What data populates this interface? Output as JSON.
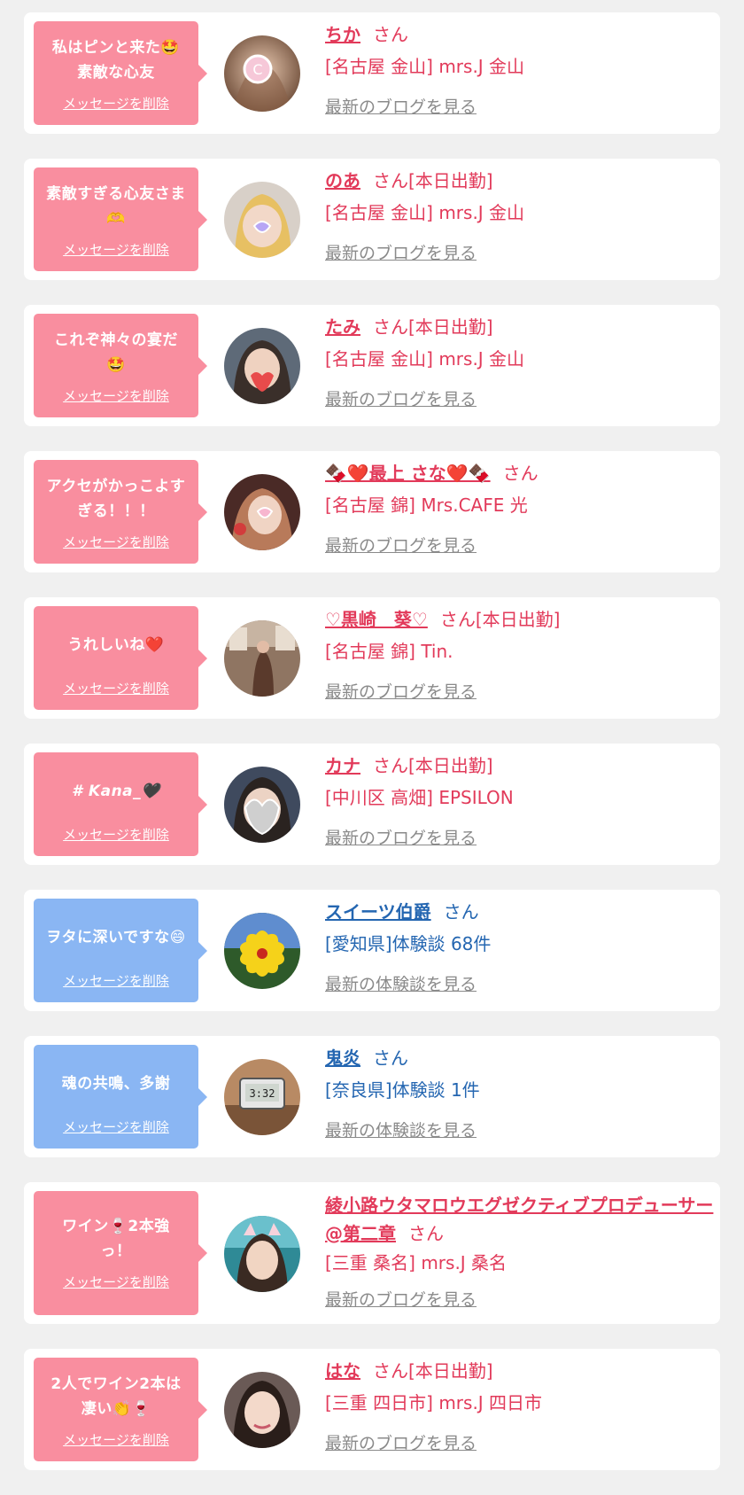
{
  "colors": {
    "pink_bubble": "#f98e9f",
    "blue_bubble": "#8ab6f3",
    "red_text": "#e23a5a",
    "blue_text": "#2466b1",
    "link_gray": "#8a8a8a",
    "page_bg": "#f0f0f0"
  },
  "delete_label": "メッセージを削除",
  "cards": [
    {
      "bubble": "pink",
      "message": "私はピンと来た🤩素敵な心友",
      "name": "ちか",
      "suffix": "さん",
      "tag": "",
      "shop": "[名古屋 金山] mrs.J 金山",
      "link": "最新のブログを見る",
      "text_color": "red",
      "avatar": "avatar-photo-1"
    },
    {
      "bubble": "pink",
      "message": "素敵すぎる心友さま🫶",
      "name": "のあ",
      "suffix": "さん",
      "tag": "[本日出勤]",
      "shop": "[名古屋 金山] mrs.J 金山",
      "link": "最新のブログを見る",
      "text_color": "red",
      "avatar": "avatar-photo-2"
    },
    {
      "bubble": "pink",
      "message": "これぞ神々の宴だ🤩",
      "name": "たみ",
      "suffix": "さん",
      "tag": "[本日出勤]",
      "shop": "[名古屋 金山] mrs.J 金山",
      "link": "最新のブログを見る",
      "text_color": "red",
      "avatar": "avatar-photo-3"
    },
    {
      "bubble": "pink",
      "message": "アクセがかっこよすぎる！！！",
      "name": "🍫❤️最上 さな❤️🍫",
      "suffix": "さん",
      "tag": "",
      "shop": "[名古屋 錦] Mrs.CAFE 光",
      "link": "最新のブログを見る",
      "text_color": "red",
      "avatar": "avatar-photo-4"
    },
    {
      "bubble": "pink",
      "message": "うれしいね❤️",
      "name": "♡黒崎　葵♡",
      "suffix": "さん",
      "tag": "[本日出勤]",
      "shop": "[名古屋 錦] Tin.",
      "link": "最新のブログを見る",
      "text_color": "red",
      "avatar": "avatar-photo-5"
    },
    {
      "bubble": "pink",
      "message": "# Kana_🖤",
      "name": "カナ",
      "suffix": "さん",
      "tag": "[本日出勤]",
      "shop": "[中川区 高畑] EPSILON",
      "link": "最新のブログを見る",
      "text_color": "red",
      "avatar": "avatar-photo-6"
    },
    {
      "bubble": "blue",
      "message": "ヲタに深いですな😄",
      "name": "スイーツ伯爵",
      "suffix": "さん",
      "tag": "",
      "shop": "[愛知県]体験談 68件",
      "link": "最新の体験談を見る",
      "text_color": "blue",
      "avatar": "avatar-flower"
    },
    {
      "bubble": "blue",
      "message": "魂の共鳴、多謝",
      "name": "鬼炎",
      "suffix": "さん",
      "tag": "",
      "shop": "[奈良県]体験談 1件",
      "link": "最新の体験談を見る",
      "text_color": "blue",
      "avatar": "avatar-clock"
    },
    {
      "bubble": "pink",
      "message": "ワイン🍷2本強っ！",
      "name": "綾小路ウタマロウエグゼクティブプロデューサー@第二章",
      "suffix": "さん",
      "tag": "",
      "shop": "[三重 桑名] mrs.J 桑名",
      "link": "最新のブログを見る",
      "text_color": "red",
      "avatar": "avatar-photo-9"
    },
    {
      "bubble": "pink",
      "message": "2人でワイン2本は凄い👏🍷",
      "name": "はな",
      "suffix": "さん",
      "tag": "[本日出勤]",
      "shop": "[三重 四日市] mrs.J 四日市",
      "link": "最新のブログを見る",
      "text_color": "red",
      "avatar": "avatar-photo-10"
    }
  ]
}
